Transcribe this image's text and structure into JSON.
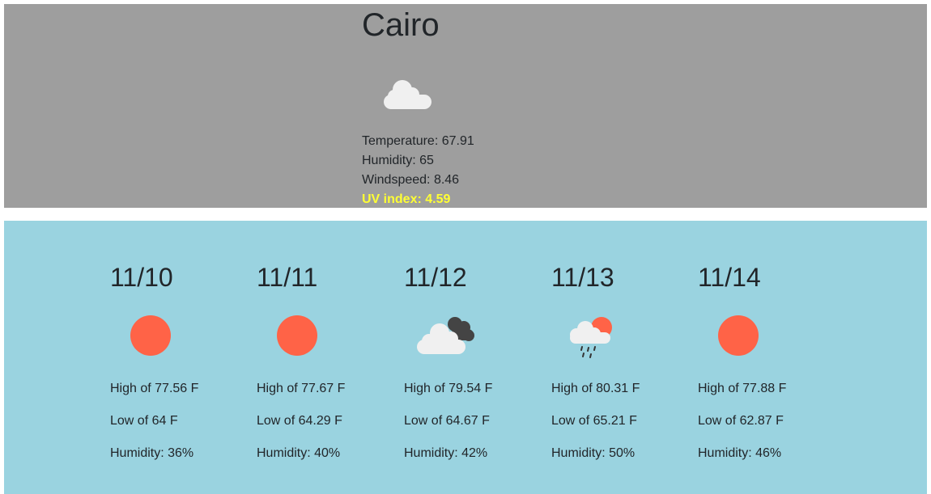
{
  "current": {
    "city": "Cairo",
    "icon": "cloud-icon",
    "temperature_label": "Temperature: 67.91",
    "humidity_label": "Humidity: 65",
    "windspeed_label": "Windspeed: 8.46",
    "uv_label": "UV index: 4.59",
    "uv_color": "#ffff33",
    "panel_color": "#9e9e9e"
  },
  "forecast": {
    "panel_color": "#9ad3e0",
    "days": [
      {
        "date": "11/10",
        "icon": "sun-icon",
        "high": "High of 77.56 F",
        "low": "Low of 64 F",
        "humidity": "Humidity: 36%"
      },
      {
        "date": "11/11",
        "icon": "sun-icon",
        "high": "High of 77.67 F",
        "low": "Low of 64.29 F",
        "humidity": "Humidity: 40%"
      },
      {
        "date": "11/12",
        "icon": "clouds-icon",
        "high": "High of 79.54 F",
        "low": "Low of 64.67 F",
        "humidity": "Humidity: 42%"
      },
      {
        "date": "11/13",
        "icon": "rain-sun-icon",
        "high": "High of 80.31 F",
        "low": "Low of 65.21 F",
        "humidity": "Humidity: 50%"
      },
      {
        "date": "11/14",
        "icon": "sun-icon",
        "high": "High of 77.88 F",
        "low": "Low of 62.87 F",
        "humidity": "Humidity: 46%"
      }
    ]
  }
}
